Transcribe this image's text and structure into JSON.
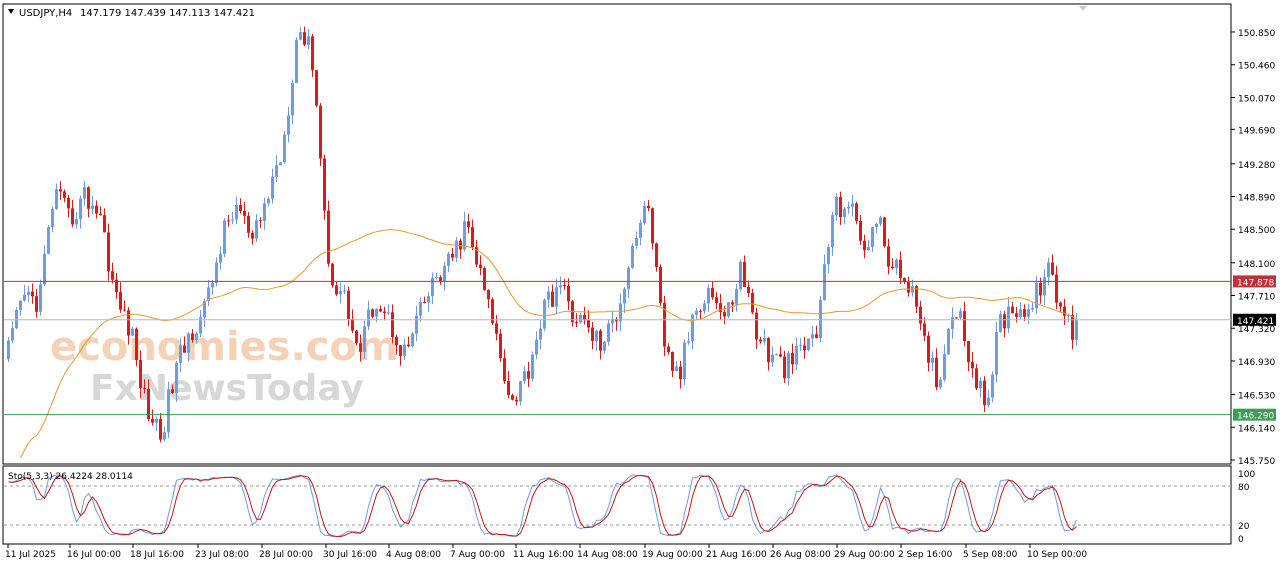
{
  "header": {
    "symbol_timeframe": "USDJPY,H4",
    "ohlc_text": "147.179 147.439 147.113 147.421"
  },
  "watermark": {
    "line1": "economies.com",
    "line2": "FxNewsToday"
  },
  "colors": {
    "bull_candle": "#6f9be0",
    "bear_candle": "#d81c1c",
    "moving_average": "#e89a2a",
    "resistance_line": "#c0303a",
    "support_line": "#3a9e55",
    "stoch_main": "#6f9be0",
    "stoch_signal": "#c01818"
  },
  "price_axis": {
    "ticks": [
      "150.850",
      "150.460",
      "150.070",
      "149.690",
      "149.280",
      "148.890",
      "148.500",
      "148.100",
      "147.710",
      "147.320",
      "146.930",
      "146.530",
      "146.140",
      "145.750"
    ]
  },
  "time_axis": {
    "labels": [
      "11 Jul 2025",
      "16 Jul 00:00",
      "18 Jul 16:00",
      "23 Jul 08:00",
      "28 Jul 00:00",
      "30 Jul 16:00",
      "4 Aug 08:00",
      "7 Aug 00:00",
      "11 Aug 16:00",
      "14 Aug 08:00",
      "19 Aug 00:00",
      "21 Aug 16:00",
      "26 Aug 08:00",
      "29 Aug 00:00",
      "2 Sep 16:00",
      "5 Sep 08:00",
      "10 Sep 00:00"
    ]
  },
  "levels": {
    "resistance": "147.878",
    "current": "147.421",
    "support": "146.290"
  },
  "stochastic": {
    "label": "Sto(5,3,3) 26.4224 28.0114",
    "scale_ticks": [
      "100",
      "80",
      "20",
      "0"
    ]
  },
  "chart_data": [
    {
      "type": "candlestick",
      "title": "USDJPY,H4",
      "x": [
        "11 Jul 2025",
        "16 Jul 00:00",
        "18 Jul 16:00",
        "23 Jul 08:00",
        "28 Jul 00:00",
        "30 Jul 16:00",
        "4 Aug 08:00",
        "7 Aug 00:00",
        "11 Aug 16:00",
        "14 Aug 08:00",
        "19 Aug 00:00",
        "21 Aug 16:00",
        "26 Aug 08:00",
        "29 Aug 00:00",
        "2 Sep 16:00",
        "5 Sep 08:00",
        "10 Sep 00:00"
      ],
      "price_path": [
        147.05,
        147.7,
        147.65,
        148.95,
        148.6,
        148.9,
        148.7,
        147.7,
        147.3,
        146.4,
        146.05,
        146.85,
        147.3,
        147.6,
        148.4,
        148.8,
        148.3,
        148.9,
        149.5,
        150.95,
        150.5,
        148.0,
        147.7,
        147.0,
        147.7,
        147.4,
        147.0,
        147.5,
        147.9,
        148.1,
        148.55,
        147.9,
        147.2,
        146.45,
        146.8,
        147.5,
        147.85,
        147.5,
        147.3,
        147.1,
        147.6,
        148.4,
        148.8,
        147.0,
        146.75,
        147.6,
        147.8,
        147.4,
        148.05,
        147.3,
        146.95,
        146.85,
        147.05,
        147.3,
        148.7,
        148.85,
        148.3,
        148.6,
        148.0,
        147.9,
        147.1,
        146.7,
        147.7,
        147.0,
        146.35,
        147.4,
        147.6,
        147.5,
        148.05,
        147.55,
        147.2
      ],
      "ylim": [
        145.75,
        151.0
      ],
      "levels": {
        "resistance": 147.878,
        "current": 147.421,
        "support": 146.29
      }
    },
    {
      "type": "line",
      "title": "Sto(5,3,3)",
      "series": [
        {
          "name": "26.4224"
        },
        {
          "name": "28.0114"
        }
      ],
      "ylim": [
        0,
        100
      ],
      "levels": [
        20,
        80
      ],
      "last_values": [
        26.4224,
        28.0114
      ]
    }
  ]
}
